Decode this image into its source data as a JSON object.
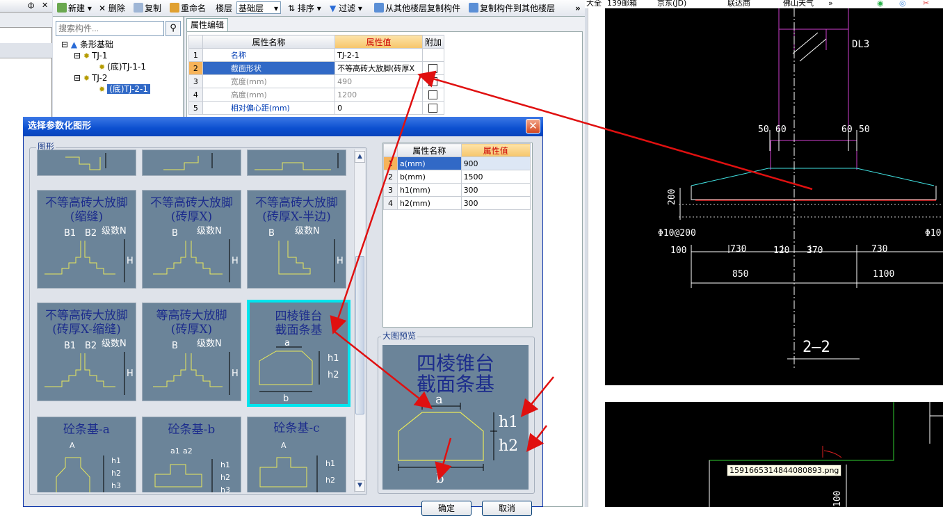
{
  "left_pane": {
    "pin": "ф",
    "close": "✕"
  },
  "toolbar": {
    "new_label": "新建",
    "delete_label": "删除",
    "copy_label": "复制",
    "rename_label": "重命名",
    "floor_label": "楼层",
    "floor_value": "基础层",
    "sort_label": "排序",
    "filter_label": "过滤",
    "copy_from_floor_label": "从其他楼层复制构件",
    "copy_to_floor_label": "复制构件到其他楼层",
    "more": "»"
  },
  "tree": {
    "search_placeholder": "搜索构件...",
    "root": "条形基础",
    "items": [
      "TJ-1",
      "(底)TJ-1-1",
      "TJ-2",
      "(底)TJ-2-1"
    ]
  },
  "property_editor": {
    "tab": "属性编辑",
    "headers": {
      "name": "属性名称",
      "value": "属性值",
      "extra": "附加"
    },
    "rows": [
      {
        "num": "1",
        "name": "名称",
        "value": "TJ-2-1"
      },
      {
        "num": "2",
        "name": "截面形状",
        "value": "不等高砖大放脚(砖厚X"
      },
      {
        "num": "3",
        "name": "宽度(mm)",
        "value": "490"
      },
      {
        "num": "4",
        "name": "高度(mm)",
        "value": "1200"
      },
      {
        "num": "5",
        "name": "相对偏心距(mm)",
        "value": "0"
      }
    ]
  },
  "dialog": {
    "title": "选择参数化图形",
    "close": "✕",
    "shape_group_label": "图形",
    "preview_group_label": "大图预览",
    "ok_label": "确定",
    "cancel_label": "取消",
    "tiles": [
      {
        "line1": "不等高砖大放脚",
        "line2": "(缩缝)",
        "labels": [
          "B1",
          "B2",
          "级数N",
          "H"
        ]
      },
      {
        "line1": "不等高砖大放脚",
        "line2": "(砖厚X)",
        "labels": [
          "B",
          "级数N",
          "H"
        ]
      },
      {
        "line1": "不等高砖大放脚",
        "line2": "(砖厚X-半边)",
        "labels": [
          "B",
          "级数N",
          "H"
        ]
      },
      {
        "line1": "不等高砖大放脚",
        "line2": "(砖厚X-缩缝)",
        "labels": [
          "B1",
          "B2",
          "级数N",
          "H"
        ]
      },
      {
        "line1": "等高砖大放脚",
        "line2": "(砖厚X)",
        "labels": [
          "B",
          "级数N",
          "H"
        ]
      },
      {
        "line1": "四棱锥台",
        "line2": "截面条基",
        "labels": [
          "a",
          "h1",
          "h2",
          "b"
        ]
      },
      {
        "line1": "砼条基-a",
        "line2": "",
        "labels": [
          "A",
          "h1",
          "h2",
          "h3"
        ]
      },
      {
        "line1": "砼条基-b",
        "line2": "",
        "labels": [
          "a1",
          "a2",
          "h1",
          "h2",
          "h3"
        ]
      },
      {
        "line1": "砼条基-c",
        "line2": "",
        "labels": [
          "A",
          "h1",
          "h2"
        ]
      }
    ],
    "param_table": {
      "headers": {
        "name": "属性名称",
        "value": "属性值"
      },
      "rows": [
        {
          "num": "1",
          "name": "a(mm)",
          "value": "900"
        },
        {
          "num": "2",
          "name": "b(mm)",
          "value": "1500"
        },
        {
          "num": "3",
          "name": "h1(mm)",
          "value": "300"
        },
        {
          "num": "4",
          "name": "h2(mm)",
          "value": "300"
        }
      ]
    },
    "preview": {
      "line1": "四棱锥台",
      "line2": "截面条基",
      "labels": [
        "a",
        "h1",
        "h2",
        "b"
      ]
    }
  },
  "bookmarks": [
    "大全",
    "139邮箱",
    "京东(JD)",
    "联达商",
    "佛山天气",
    "»"
  ],
  "cad": {
    "labels": [
      "DL3",
      "50",
      "60",
      "60",
      "50",
      "200",
      "Φ10@200",
      "Φ10",
      "100",
      "730",
      "120",
      "370",
      "730",
      "850",
      "1100",
      "2—2",
      "100"
    ],
    "filename": "1591665314844080893.png"
  },
  "colors": {
    "tile_bg": "#6b8499",
    "tile_text": "#1c2c8c",
    "selection": "#00e5ee",
    "arrow": "#e01010",
    "title_bar": "#0b4fcf"
  }
}
